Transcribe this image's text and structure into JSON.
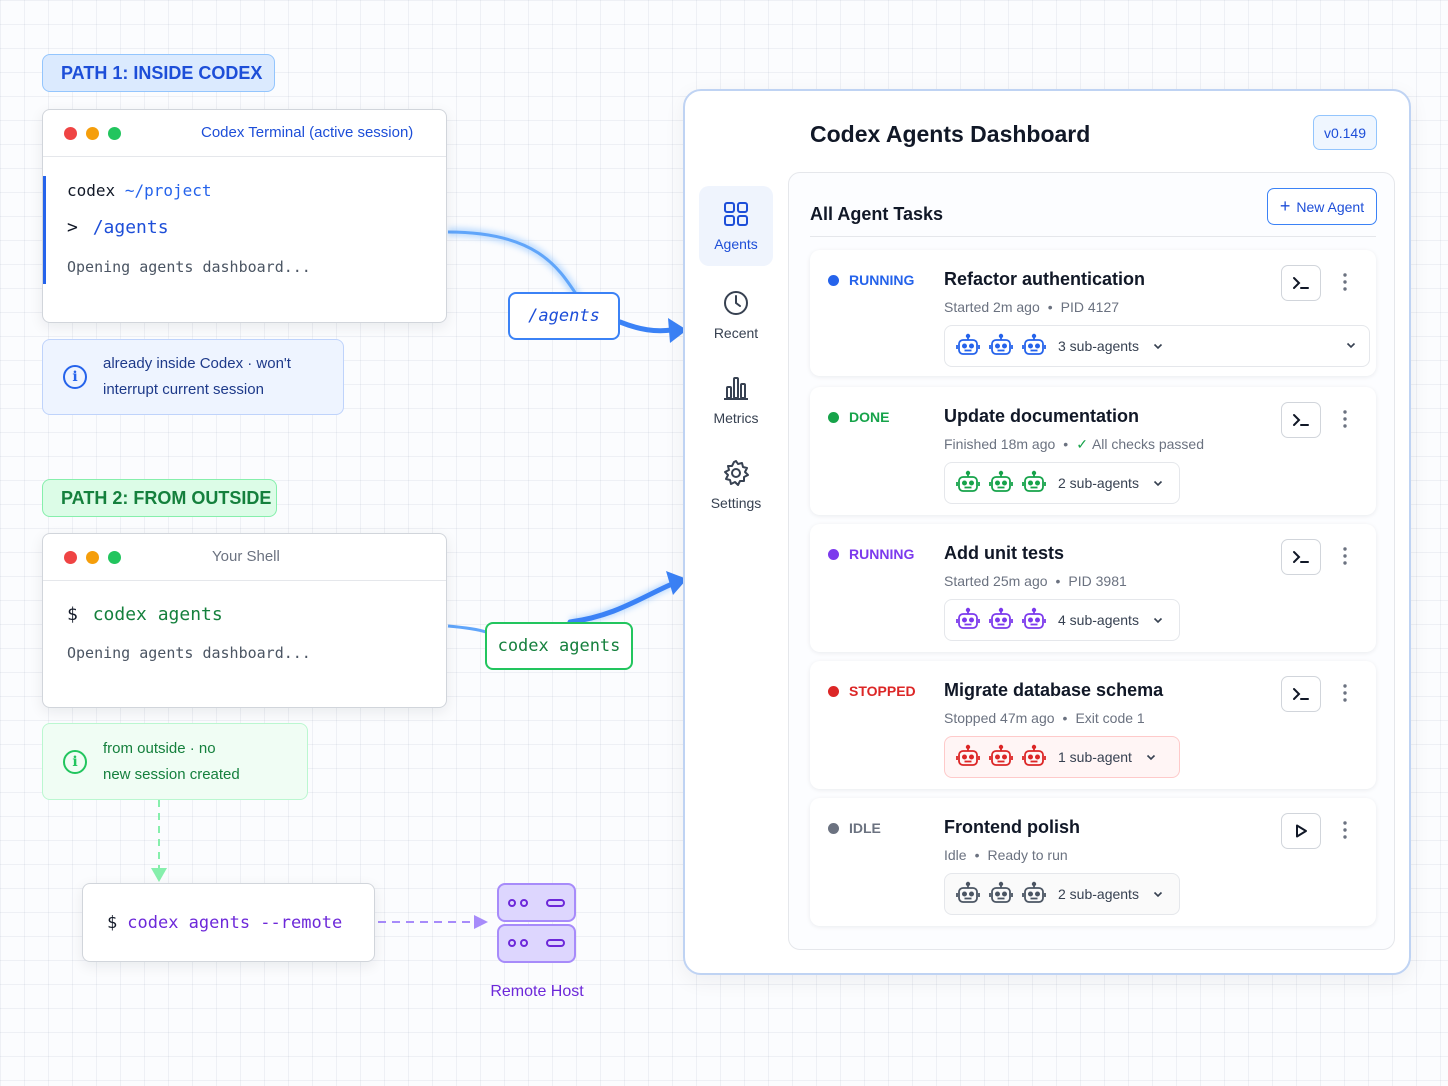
{
  "path1": {
    "label": "PATH 1: INSIDE CODEX",
    "terminal": {
      "title": "Codex Terminal (active session)",
      "prompt_cmd": "codex",
      "prompt_dir": "~/project",
      "input_marker": ">",
      "input_cmd": "/agents",
      "output": "Opening agents dashboard..."
    },
    "note_line1": "already inside Codex · won't",
    "note_line2": "interrupt current session",
    "arrow_label": "/agents"
  },
  "path2": {
    "label": "PATH 2: FROM OUTSIDE",
    "terminal": {
      "title": "Your Shell",
      "prompt": "$",
      "cmd": "codex agents",
      "output": "Opening agents dashboard..."
    },
    "note_line1": "from outside · no",
    "note_line2": "new session created",
    "arrow_label": "codex agents"
  },
  "remote": {
    "prompt": "$",
    "cmd": "codex agents --remote",
    "host_label": "Remote Host"
  },
  "dashboard": {
    "title": "Codex Agents Dashboard",
    "version": "v0.149",
    "nav": [
      {
        "label": "Agents",
        "icon": "grid-icon",
        "active": true
      },
      {
        "label": "Recent",
        "icon": "clock-icon",
        "active": false
      },
      {
        "label": "Metrics",
        "icon": "bar-chart-icon",
        "active": false
      },
      {
        "label": "Settings",
        "icon": "gear-icon",
        "active": false
      }
    ],
    "panel_title": "All Agent Tasks",
    "new_agent_plus": "+",
    "new_agent_label": "New Agent",
    "meta_separator": "•",
    "tasks": [
      {
        "status": "RUNNING",
        "status_color": "#2563eb",
        "name": "Refactor authentication",
        "meta1": "Started 2m ago",
        "meta2": "PID 4127",
        "check": "",
        "subagents": "3 sub-agents",
        "action_icon": "terminal-icon",
        "robot_color": "#2563eb"
      },
      {
        "status": "DONE",
        "status_color": "#16a34a",
        "name": "Update documentation",
        "meta1": "Finished 18m ago",
        "meta2": "All checks passed",
        "check": "✓",
        "subagents": "2 sub-agents",
        "action_icon": "terminal-icon",
        "robot_color": "#16a34a"
      },
      {
        "status": "RUNNING",
        "status_color": "#7c3aed",
        "name": "Add unit tests",
        "meta1": "Started 25m ago",
        "meta2": "PID 3981",
        "check": "",
        "subagents": "4 sub-agents",
        "action_icon": "terminal-icon",
        "robot_color": "#7c3aed"
      },
      {
        "status": "STOPPED",
        "status_color": "#dc2626",
        "name": "Migrate database schema",
        "meta1": "Stopped 47m ago",
        "meta2": "Exit code 1",
        "check": "",
        "subagents": "1 sub-agent",
        "action_icon": "terminal-icon",
        "robot_color": "#dc2626"
      },
      {
        "status": "IDLE",
        "status_color": "#6b7280",
        "name": "Frontend polish",
        "meta1": "Idle",
        "meta2": "Ready to run",
        "check": "",
        "subagents": "2 sub-agents",
        "action_icon": "play-icon",
        "robot_color": "#4b5563"
      }
    ]
  }
}
